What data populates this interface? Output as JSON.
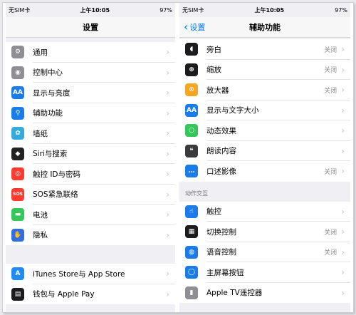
{
  "left": {
    "status": {
      "carrier": "无SIM卡",
      "time": "上午10:05",
      "battery": "97%"
    },
    "title": "设置",
    "groups": [
      [
        {
          "icon": "gear-icon",
          "label": "通用",
          "color": "#8e8e93",
          "glyph": "⚙"
        },
        {
          "icon": "toggles-icon",
          "label": "控制中心",
          "color": "#8e8e93",
          "glyph": "◉"
        },
        {
          "icon": "text-size-icon",
          "label": "显示与亮度",
          "color": "#1a7ce8",
          "glyph": "AA"
        },
        {
          "icon": "accessibility-icon",
          "label": "辅助功能",
          "color": "#1a7ce8",
          "glyph": "⚲"
        },
        {
          "icon": "flower-wallpaper-icon",
          "label": "墙纸",
          "color": "#35aadc",
          "glyph": "✿"
        },
        {
          "icon": "siri-icon",
          "label": "Siri与搜索",
          "color": "#222222",
          "glyph": "◆"
        },
        {
          "icon": "fingerprint-icon",
          "label": "触控 ID与密码",
          "color": "#ff3b30",
          "glyph": "◎"
        },
        {
          "icon": "sos-icon",
          "label": "SOS紧急联络",
          "color": "#ff3b30",
          "glyph": "SOS"
        },
        {
          "icon": "battery-icon",
          "label": "电池",
          "color": "#34c759",
          "glyph": "▬"
        },
        {
          "icon": "hand-privacy-icon",
          "label": "隐私",
          "color": "#2f6fe0",
          "glyph": "✋"
        }
      ],
      [
        {
          "icon": "app-store-icon",
          "label": "iTunes Store与 App Store",
          "color": "#1f8cf5",
          "glyph": "A"
        },
        {
          "icon": "wallet-icon",
          "label": "钱包与 Apple Pay",
          "color": "#1c1c1e",
          "glyph": "▤"
        }
      ]
    ]
  },
  "right": {
    "status": {
      "carrier": "无SIM卡",
      "time": "上午10:05",
      "battery": "97%"
    },
    "back_label": "设置",
    "title": "辅助功能",
    "groups": [
      [
        {
          "icon": "voiceover-icon",
          "label": "旁白",
          "value": "关闭",
          "color": "#1c1c1e",
          "glyph": "◖"
        },
        {
          "icon": "zoom-icon",
          "label": "缩放",
          "value": "关闭",
          "color": "#1c1c1e",
          "glyph": "⊕"
        },
        {
          "icon": "magnifier-icon",
          "label": "放大器",
          "value": "关闭",
          "color": "#f5a623",
          "glyph": "⊙"
        },
        {
          "icon": "text-size-icon",
          "label": "显示与文字大小",
          "value": "",
          "color": "#1a7ce8",
          "glyph": "AA"
        },
        {
          "icon": "motion-icon",
          "label": "动态效果",
          "value": "",
          "color": "#34c759",
          "glyph": "○"
        },
        {
          "icon": "speech-icon",
          "label": "朗读内容",
          "value": "",
          "color": "#3a3a3c",
          "glyph": "❝"
        },
        {
          "icon": "audio-description-icon",
          "label": "口述影像",
          "value": "关闭",
          "color": "#1a7ce8",
          "glyph": "…"
        }
      ]
    ],
    "section_header": "动作交互",
    "groups2": [
      [
        {
          "icon": "touch-icon",
          "label": "触控",
          "value": "",
          "color": "#1a7ce8",
          "glyph": "☝"
        },
        {
          "icon": "switch-control-icon",
          "label": "切换控制",
          "value": "关闭",
          "color": "#1c1c1e",
          "glyph": "▦"
        },
        {
          "icon": "voice-control-icon",
          "label": "语音控制",
          "value": "关闭",
          "color": "#1a7ce8",
          "glyph": "◍"
        },
        {
          "icon": "home-button-icon",
          "label": "主屏幕按钮",
          "value": "",
          "color": "#1a7ce8",
          "glyph": "◯"
        },
        {
          "icon": "apple-tv-remote-icon",
          "label": "Apple TV遥控器",
          "value": "",
          "color": "#8e8e93",
          "glyph": "▮"
        }
      ]
    ]
  },
  "chevron": "›"
}
